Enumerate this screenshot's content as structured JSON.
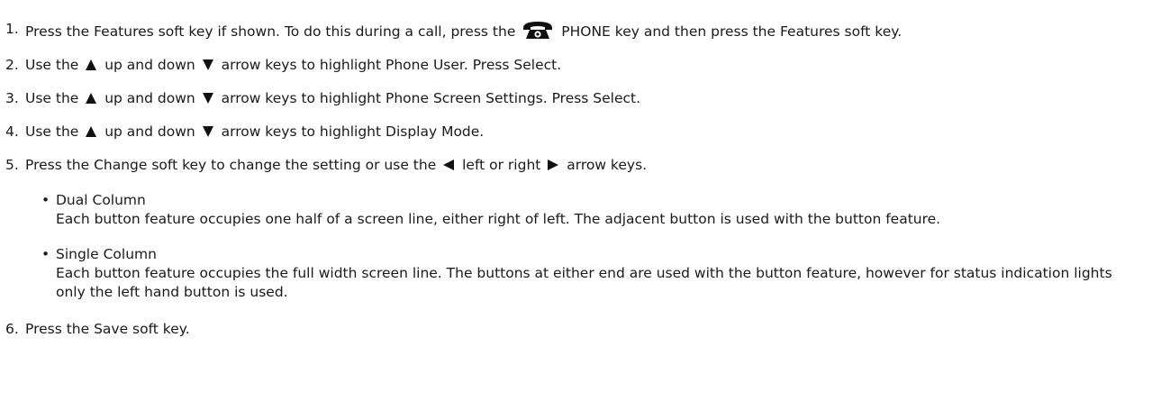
{
  "steps": [
    {
      "num": "1.",
      "text_a": "Press the Features soft key if shown. To do this during a call, press the",
      "phone_key": "PHONE",
      "text_b": "key and then press the Features soft key."
    },
    {
      "num": "2.",
      "text_a": "Use the",
      "text_b": "up and down",
      "text_c": "arrow keys to highlight Phone User. Press Select."
    },
    {
      "num": "3.",
      "text_a": "Use the",
      "text_b": "up and down",
      "text_c": "arrow keys to highlight Phone Screen Settings. Press Select."
    },
    {
      "num": "4.",
      "text_a": "Use the",
      "text_b": "up and down",
      "text_c": "arrow keys to highlight Display Mode."
    },
    {
      "num": "5.",
      "text_a": "Press the Change soft key to change the setting or use the",
      "text_b": "left or right",
      "text_c": "arrow keys.",
      "options": [
        {
          "title": "Dual Column",
          "description": "Each button feature occupies one half of a screen line, either right of left. The adjacent button is used with the button feature."
        },
        {
          "title": "Single Column",
          "description": "Each button feature occupies the full width screen line. The buttons at either end are used with the button feature, however for status indication lights only the left hand button is used."
        }
      ]
    },
    {
      "num": "6.",
      "text_a": "Press the Save soft key."
    }
  ],
  "icons": {
    "phone": "phone-icon",
    "up": "up-arrow-icon",
    "down": "down-arrow-icon",
    "left": "left-arrow-icon",
    "right": "right-arrow-icon"
  },
  "colors": {
    "text": "#1a1a1a",
    "icon": "#111111"
  },
  "bullet_glyph": "•"
}
